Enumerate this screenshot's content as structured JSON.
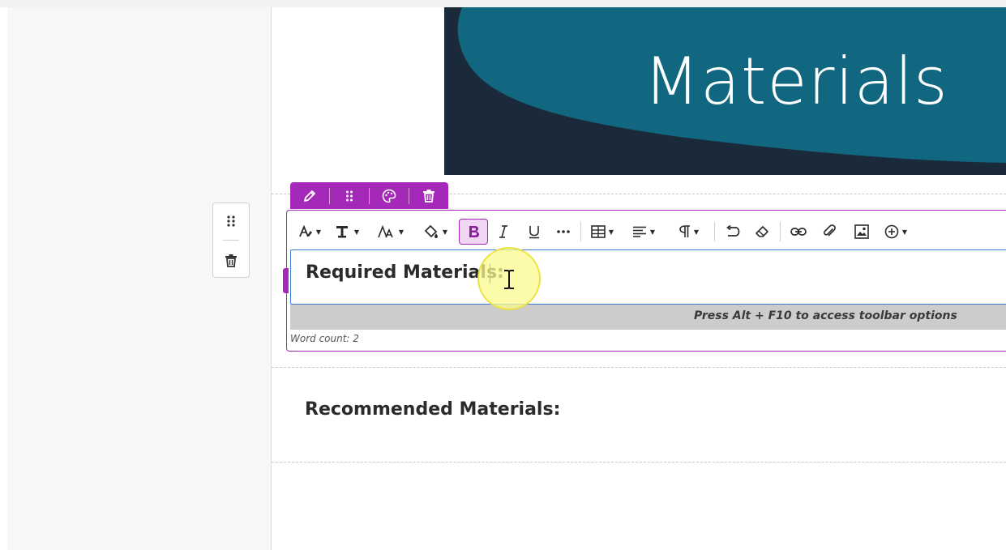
{
  "banner": {
    "title": "Materials"
  },
  "side_toolbox": {
    "items": [
      {
        "icon": "drag-grid-icon"
      },
      {
        "icon": "trash-icon"
      }
    ]
  },
  "block_toolbar": {
    "items": [
      {
        "icon": "pencil-icon"
      },
      {
        "icon": "drag-grid-icon"
      },
      {
        "icon": "palette-icon"
      },
      {
        "icon": "trash-icon"
      }
    ]
  },
  "format_toolbar": {
    "items": [
      {
        "icon": "text-style-icon",
        "dropdown": true
      },
      {
        "icon": "font-family-icon",
        "dropdown": true
      },
      {
        "icon": "font-size-icon",
        "dropdown": true
      },
      {
        "icon": "fill-color-icon",
        "dropdown": true
      },
      {
        "icon": "bold-icon",
        "active": true
      },
      {
        "icon": "italic-icon"
      },
      {
        "icon": "underline-icon"
      },
      {
        "icon": "more-icon"
      },
      {
        "icon": "table-icon",
        "dropdown": true
      },
      {
        "icon": "align-icon",
        "dropdown": true
      },
      {
        "icon": "paragraph-icon",
        "dropdown": true
      },
      {
        "icon": "undo-icon"
      },
      {
        "icon": "eraser-icon"
      },
      {
        "icon": "link-icon"
      },
      {
        "icon": "attach-icon"
      },
      {
        "icon": "image-icon"
      },
      {
        "icon": "insert-icon",
        "dropdown": true
      }
    ]
  },
  "editor": {
    "content": "Required Materials:",
    "hint": "Press Alt + F10 to access toolbar options",
    "word_count": "Word count: 2"
  },
  "next_block": {
    "heading": "Recommended Materials:"
  },
  "colors": {
    "accent": "#a529b8",
    "banner_teal": "#11677f",
    "banner_dark": "#1b2a3a"
  }
}
